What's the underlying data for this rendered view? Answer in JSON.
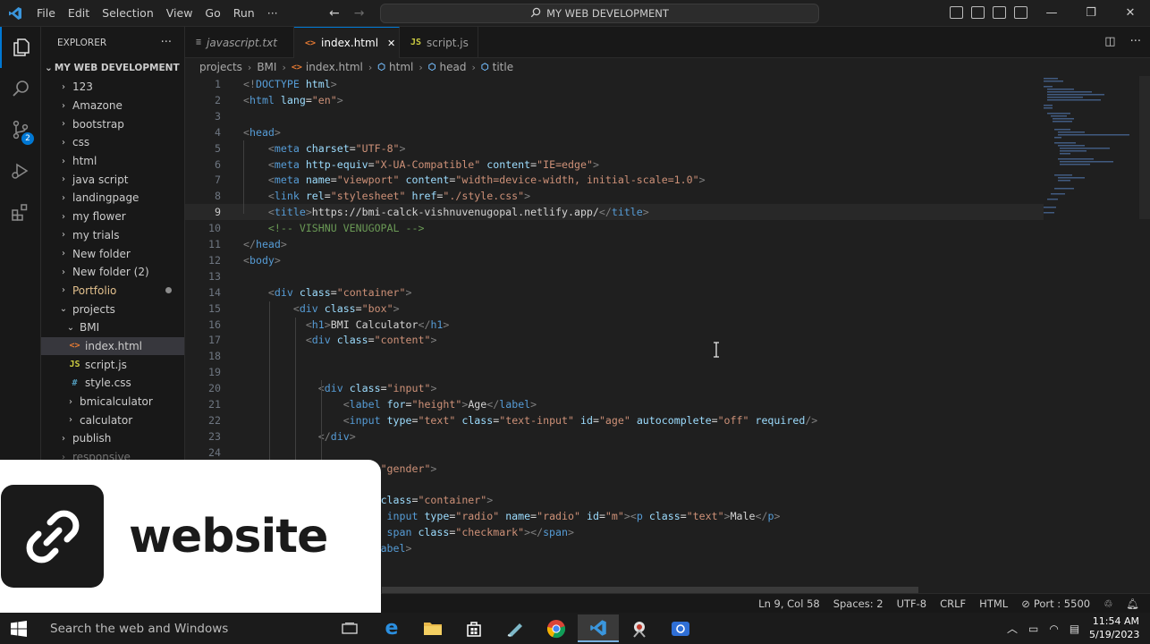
{
  "titlebar": {
    "menu": [
      "File",
      "Edit",
      "Selection",
      "View",
      "Go",
      "Run",
      "···"
    ],
    "command_center": "MY WEB DEVELOPMENT",
    "controls": {
      "minimize": "—",
      "restore": "❐",
      "close": "✕"
    }
  },
  "activity": {
    "source_control_badge": "2"
  },
  "explorer": {
    "header": "EXPLORER",
    "more": "···",
    "root": "MY WEB DEVELOPMENT",
    "items": [
      {
        "label": "123"
      },
      {
        "label": "Amazone"
      },
      {
        "label": "bootstrap"
      },
      {
        "label": "css"
      },
      {
        "label": "html"
      },
      {
        "label": "java script"
      },
      {
        "label": "landingpage"
      },
      {
        "label": "my flower"
      },
      {
        "label": "my trials"
      },
      {
        "label": "New folder"
      },
      {
        "label": "New folder (2)"
      },
      {
        "label": "Portfolio"
      },
      {
        "label": "projects"
      },
      {
        "label": "BMI"
      },
      {
        "label": "index.html",
        "icon": "<>"
      },
      {
        "label": "script.js",
        "icon": "JS"
      },
      {
        "label": "style.css",
        "icon": "#"
      },
      {
        "label": "bmicalculator"
      },
      {
        "label": "calculator"
      },
      {
        "label": "publish"
      },
      {
        "label": "responsive"
      }
    ]
  },
  "tabs": [
    {
      "label": "javascript.txt",
      "icon": "≡"
    },
    {
      "label": "index.html",
      "icon": "<>",
      "close": "✕"
    },
    {
      "label": "script.js",
      "icon": "JS"
    }
  ],
  "breadcrumb": [
    "projects",
    "BMI",
    "index.html",
    "html",
    "head",
    "title"
  ],
  "code": {
    "line_numbers": [
      "1",
      "2",
      "3",
      "4",
      "5",
      "6",
      "7",
      "8",
      "9",
      "10",
      "11",
      "12",
      "13",
      "14",
      "15",
      "16",
      "17",
      "18",
      "19",
      "20",
      "21",
      "22",
      "23",
      "24"
    ],
    "current_line": 9
  },
  "statusbar": {
    "position": "Ln 9, Col 58",
    "spaces": "Spaces: 2",
    "encoding": "UTF-8",
    "eol": "CRLF",
    "language": "HTML",
    "port": "Port : 5500"
  },
  "overlay": {
    "text": "website"
  },
  "taskbar": {
    "search_placeholder": "Search the web and Windows",
    "time": "11:54 AM",
    "date": "5/19/2023"
  },
  "colors": {
    "accent": "#0078d4",
    "tag": "#569cd6",
    "attribute": "#9cdcfe",
    "string": "#ce9178",
    "comment": "#6a9955",
    "background": "#1f1f1f"
  }
}
